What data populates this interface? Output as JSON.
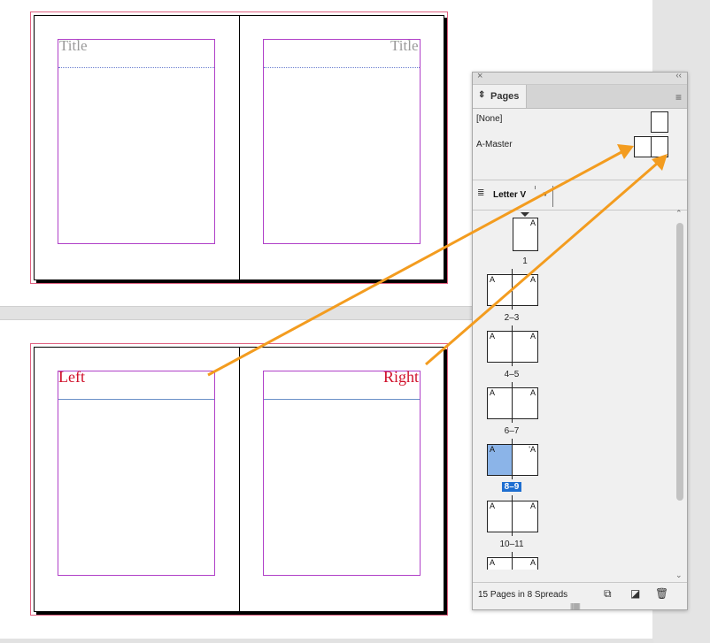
{
  "document": {
    "top_spread": {
      "left_title": "Title",
      "right_title": "Title"
    },
    "bottom_spread": {
      "left_label": "Left",
      "right_label": "Right"
    }
  },
  "panel": {
    "close_glyph": "×",
    "collapse_glyph": "‹‹",
    "tab_label": "Pages",
    "masters": [
      {
        "name": "[None]"
      },
      {
        "name": "A-Master"
      }
    ],
    "page_size": "Letter V",
    "page_thumbs": [
      {
        "label": "1",
        "letters": [
          "A"
        ],
        "selected": false
      },
      {
        "label": "2–3",
        "letters": [
          "A",
          "A"
        ],
        "selected": false
      },
      {
        "label": "4–5",
        "letters": [
          "A",
          "A"
        ],
        "selected": false
      },
      {
        "label": "6–7",
        "letters": [
          "A",
          "A"
        ],
        "selected": false
      },
      {
        "label": "8–9",
        "letters": [
          "A",
          "'A"
        ],
        "selected": true
      },
      {
        "label": "10–11",
        "letters": [
          "A",
          "A"
        ],
        "selected": false
      },
      {
        "label": "",
        "letters": [
          "A",
          "A"
        ],
        "selected": false
      }
    ],
    "footer_text": "15 Pages in 8 Spreads"
  },
  "colors": {
    "annotation_arrow": "#f39c1f",
    "margin_guide": "#b040c8",
    "bleed_guide": "#e06080",
    "label_red": "#d0102a",
    "selection_blue": "#1e6ed0"
  },
  "icons": {
    "tab_arrow": "pages-tab-arrow-icon",
    "panel_menu": "panel-menu-icon",
    "new_page": "new-page-icon",
    "edit_page_size": "edit-page-size-icon",
    "delete_page": "trash-icon"
  }
}
